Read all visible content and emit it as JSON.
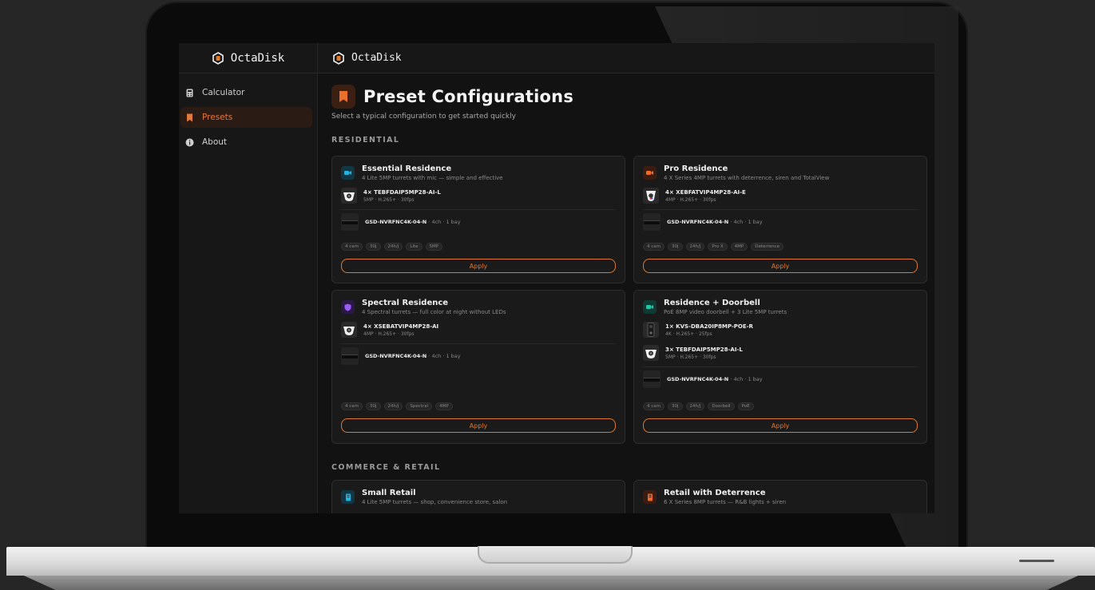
{
  "app": {
    "brand": "OctaDisk"
  },
  "sidebar": {
    "items": [
      {
        "label": "Calculator",
        "icon": "calculator-icon"
      },
      {
        "label": "Presets",
        "icon": "bookmark-icon",
        "active": true
      },
      {
        "label": "About",
        "icon": "info-icon"
      }
    ]
  },
  "page": {
    "title": "Preset Configurations",
    "subtitle": "Select a typical configuration to get started quickly"
  },
  "colors": {
    "accent": "#e07a2a",
    "bg": "#121212",
    "card": "#1a1a1a"
  },
  "sections": {
    "residential": "RESIDENTIAL",
    "commerce": "COMMERCE & RETAIL"
  },
  "cards": {
    "essential": {
      "title": "Essential Residence",
      "desc": "4 Lite 5MP turrets with mic — simple and effective",
      "device_name": "4× TEBFDAIP5MP28-AI-L",
      "device_meta": "5MP · H.265+ · 30fps",
      "nvr_name": "GSD-NVRFNC4K-04-N",
      "nvr_meta": "· 4ch · 1 bay",
      "tags": [
        "4 cam",
        "30j",
        "24h/j",
        "Lite",
        "5MP"
      ],
      "apply": "Apply"
    },
    "pro": {
      "title": "Pro Residence",
      "desc": "4 X Series 4MP turrets with deterrence, siren and TotalView",
      "device_name": "4× XEBFATVIP4MP28-AI-E",
      "device_meta": "4MP · H.265+ · 30fps",
      "nvr_name": "GSD-NVRFNC4K-04-N",
      "nvr_meta": "· 4ch · 1 bay",
      "tags": [
        "4 cam",
        "30j",
        "24h/j",
        "Pro X",
        "4MP",
        "Deterrence"
      ],
      "apply": "Apply"
    },
    "spectral": {
      "title": "Spectral Residence",
      "desc": "4 Spectral turrets — full color at night without LEDs",
      "device_name": "4× XSEBATVIP4MP28-AI",
      "device_meta": "4MP · H.265+ · 30fps",
      "nvr_name": "GSD-NVRFNC4K-04-N",
      "nvr_meta": "· 4ch · 1 bay",
      "tags": [
        "4 cam",
        "30j",
        "24h/j",
        "Spectral",
        "4MP"
      ],
      "apply": "Apply"
    },
    "doorbell": {
      "title": "Residence + Doorbell",
      "desc": "PoE 8MP video doorbell + 3 Lite 5MP turrets",
      "device_name": "1× KVS-DBA20IP8MP-POE-R",
      "device_meta": "4K · H.265+ · 25fps",
      "device2_name": "3× TEBFDAIP5MP28-AI-L",
      "device2_meta": "5MP · H.265+ · 30fps",
      "nvr_name": "GSD-NVRFNC4K-04-N",
      "nvr_meta": "· 4ch · 1 bay",
      "tags": [
        "4 cam",
        "30j",
        "24h/j",
        "Doorbell",
        "PoE"
      ],
      "apply": "Apply"
    },
    "small_retail": {
      "title": "Small Retail",
      "desc": "4 Lite 5MP turrets — shop, convenience store, salon"
    },
    "retail_deterrence": {
      "title": "Retail with Deterrence",
      "desc": "6 X Series 8MP turrets — R&B lights + siren"
    }
  }
}
